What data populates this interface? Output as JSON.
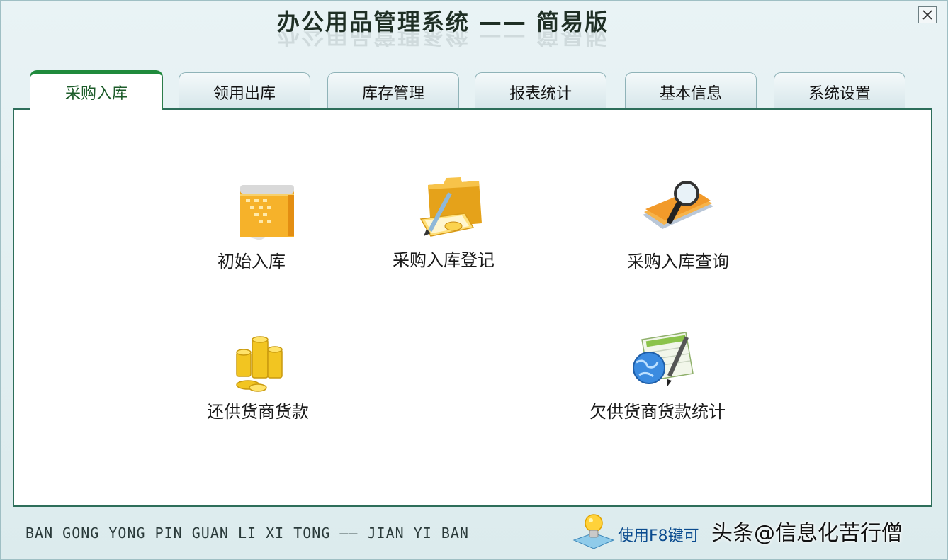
{
  "app": {
    "title": "办公用品管理系统 —— 简易版",
    "subtitle_pinyin": "BAN GONG YONG PIN GUAN LI XI TONG —— JIAN YI BAN"
  },
  "tabs": [
    {
      "label": "采购入库",
      "active": true
    },
    {
      "label": "领用出库"
    },
    {
      "label": "库存管理"
    },
    {
      "label": "报表统计"
    },
    {
      "label": "基本信息"
    },
    {
      "label": "系统设置"
    }
  ],
  "panel": {
    "items": [
      {
        "label": "初始入库",
        "icon": "book-icon"
      },
      {
        "label": "采购入库登记",
        "icon": "folder-pen-icon"
      },
      {
        "label": "采购入库查询",
        "icon": "magnifier-docs-icon"
      },
      {
        "label": "还供货商货款",
        "icon": "coins-icon"
      },
      {
        "label": "欠供货商货款统计",
        "icon": "globe-pen-icon"
      }
    ]
  },
  "footer": {
    "hint": "使用F8键可",
    "watermark": "头条@信息化苦行僧"
  },
  "colors": {
    "accent": "#1f8a3c",
    "panel_border": "#2d6e5a",
    "hint_text": "#0b4c8f"
  }
}
